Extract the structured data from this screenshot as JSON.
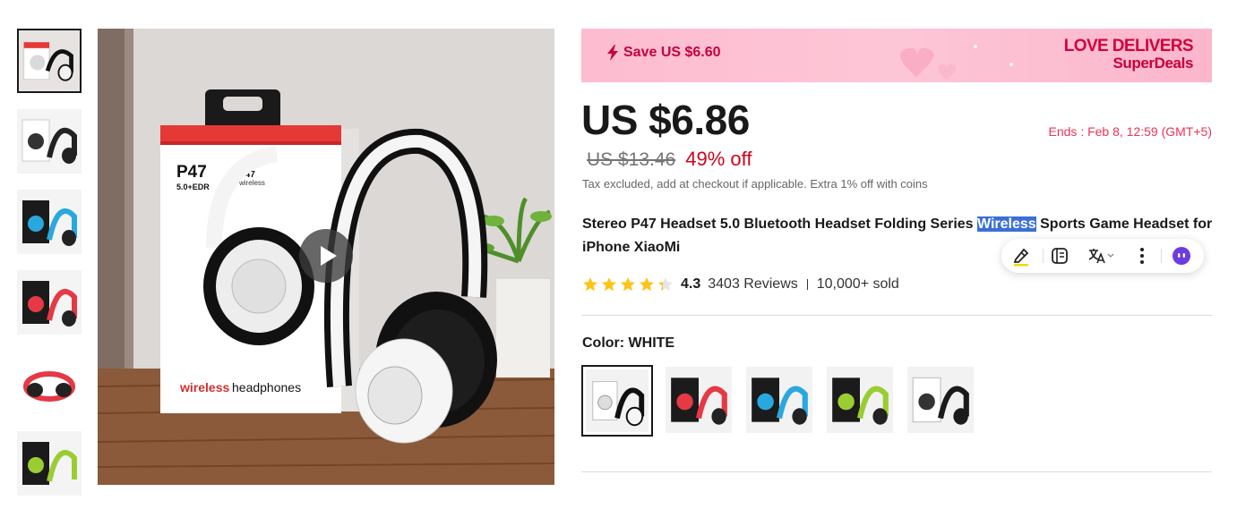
{
  "banner": {
    "save_text": "Save US $6.60",
    "brand_line1": "LOVE DELIVERS",
    "brand_line2": "SuperDeals"
  },
  "price": {
    "current": "US $6.86",
    "original": "US $13.46",
    "discount": "49% off",
    "ends": "Ends :  Feb 8, 12:59 (GMT+5)",
    "tax_note": "Tax excluded, add at checkout if applicable. Extra 1% off with coins"
  },
  "product": {
    "title_before": "Stereo P47 Headset 5.0 Bluetooth Headset Folding Series ",
    "title_highlight": "Wireless",
    "title_after": " Sports Game Headset for iPhone XiaoMi"
  },
  "rating": {
    "value": "4.3",
    "stars_filled": 4.3,
    "stars_total": 5,
    "reviews": "3403 Reviews",
    "sold": "10,000+ sold"
  },
  "color": {
    "label": "Color: ",
    "selected": "WHITE",
    "options": [
      "white",
      "red",
      "blue",
      "green",
      "black"
    ]
  },
  "main_image": {
    "box_model": "P47",
    "box_version": "5.0+EDR",
    "box_model_small": "P47",
    "box_wireless": "wireless",
    "box_caption_colored": "wireless",
    "box_caption": " headphones"
  },
  "selection_toolbar": {
    "icons": [
      "highlighter-icon",
      "notes-icon",
      "translate-icon",
      "more-icon",
      "assistant-icon"
    ]
  },
  "colors": {
    "accent_red": "#d0021b",
    "banner_pink": "#fdbcd0",
    "highlight_blue": "#3b6fd6",
    "star_yellow": "#fcc419"
  }
}
